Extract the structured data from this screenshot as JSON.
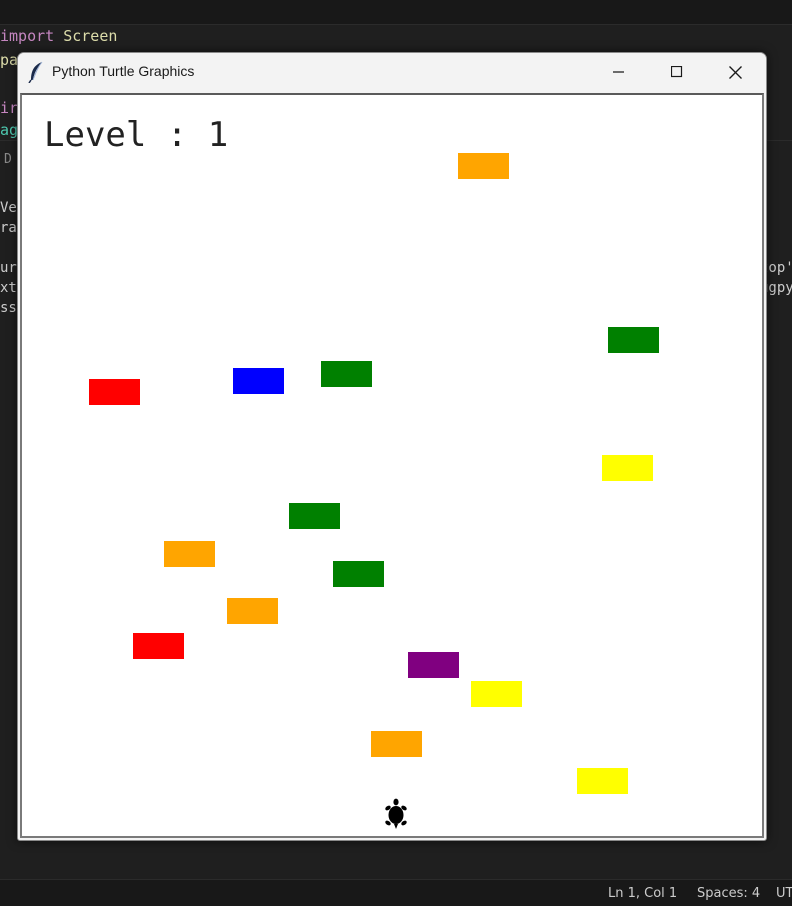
{
  "editor": {
    "line1_kw": "import",
    "line1_id": "Screen",
    "frag1": "pap",
    "frag2": "ir",
    "frag3": "ag",
    "pane_tab": "D",
    "term_left": [
      "Ve",
      "ra",
      "",
      "ur",
      "xt",
      "ss"
    ],
    "term_right": [
      "top'",
      "ugpy"
    ]
  },
  "status": {
    "position": "Ln 1, Col 1",
    "spaces": "Spaces: 4",
    "encoding": "UT"
  },
  "window": {
    "title": "Python Turtle Graphics",
    "icons": [
      "feather-icon",
      "minimize-icon",
      "maximize-icon",
      "close-icon"
    ]
  },
  "game": {
    "level_label": "Level : 1",
    "bricks": [
      {
        "color": "#ffa500"
      },
      {
        "color": "#008000"
      },
      {
        "color": "#ff0000"
      },
      {
        "color": "#0000ff"
      },
      {
        "color": "#008000"
      },
      {
        "color": "#ffff00"
      },
      {
        "color": "#008000"
      },
      {
        "color": "#ffa500"
      },
      {
        "color": "#008000"
      },
      {
        "color": "#ffa500"
      },
      {
        "color": "#ff0000"
      },
      {
        "color": "#800080"
      },
      {
        "color": "#ffff00"
      },
      {
        "color": "#ffa500"
      },
      {
        "color": "#ffff00"
      }
    ],
    "player": {
      "icon": "turtle-icon",
      "color": "#000000"
    }
  }
}
